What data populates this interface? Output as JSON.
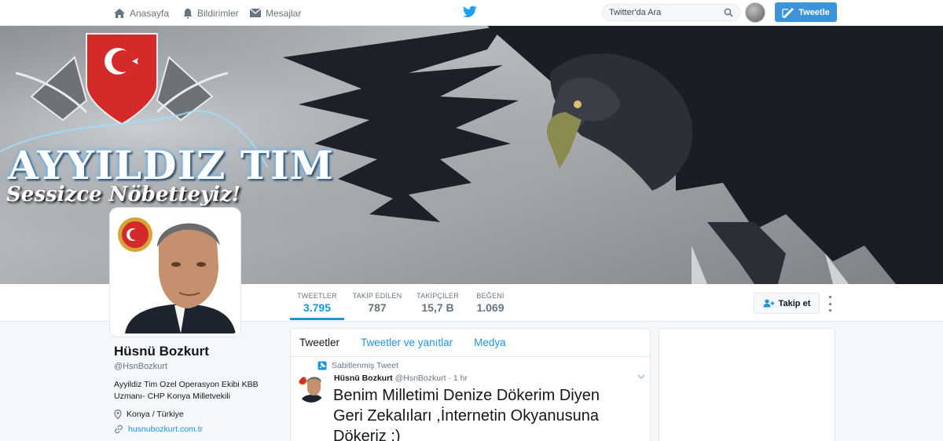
{
  "nav": {
    "home": "Anasayfa",
    "notifications": "Bildirimler",
    "messages": "Mesajlar",
    "search_placeholder": "Twitter'da Ara",
    "tweet_button": "Tweetle"
  },
  "banner": {
    "title": "AYYILDIZ TIM",
    "subtitle": "Sessizce Nöbetteyiz!",
    "emblem_text": "AYYILDIZ TIM"
  },
  "stats": [
    {
      "label": "TWEETLER",
      "value": "3.795"
    },
    {
      "label": "TAKİP EDİLEN",
      "value": "787"
    },
    {
      "label": "TAKİPÇİLER",
      "value": "15,7 B"
    },
    {
      "label": "BEĞENİ",
      "value": "1.069"
    }
  ],
  "follow_button": "Takip et",
  "profile": {
    "name": "Hüsnü Bozkurt",
    "handle": "@HsnBozkurt",
    "bio": "Ayyildiz Tim Ozel Operasyon Ekibi KBB Uzmanı- CHP Konya Milletvekili",
    "location": "Konya / Türkiye",
    "website": "husnubozkurt.com.tr"
  },
  "timeline": {
    "tabs": [
      "Tweetler",
      "Tweetler ve yanıtlar",
      "Medya"
    ],
    "pinned_label": "Sabitlenmiş Tweet",
    "tweet": {
      "name": "Hüsnü Bozkurt",
      "handle": "@HsnBozkurt",
      "time": "· 1 hr",
      "text": "Benim Milletimi Denize Dökerim Diyen Geri Zekalıları ,İnternetin Okyanusuna Dökeriz :)"
    }
  },
  "colors": {
    "accent": "#1b95e0",
    "tweet_button": "#3b94d9",
    "emblem_red": "#d42a2a"
  }
}
